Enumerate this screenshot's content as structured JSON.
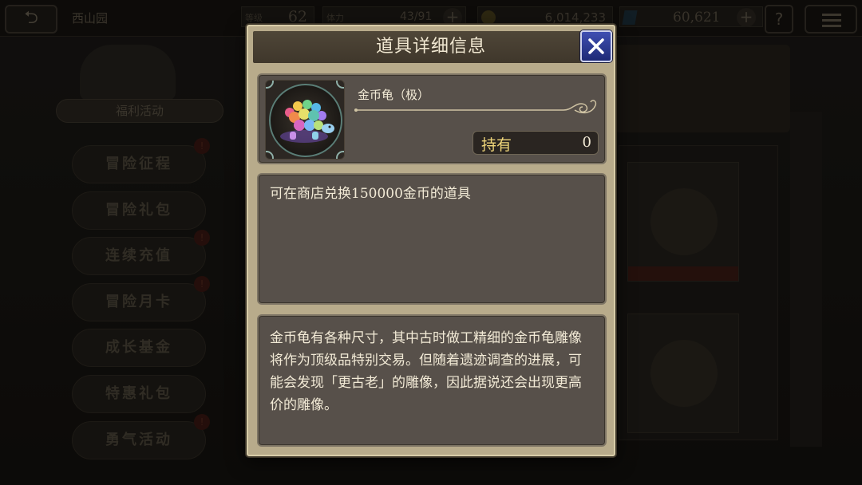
{
  "topbar": {
    "back_icon": "back-arrow-icon",
    "player_name": "西山园",
    "level_label": "等级",
    "level_value": "62",
    "stamina_label": "体力",
    "stamina_value": "43/91",
    "gil_value": "6,014,233",
    "gem_value": "60,621",
    "help_label": "?",
    "plus_label": "+"
  },
  "sidebar": {
    "header": "福利活动",
    "items": [
      {
        "label": "冒险征程",
        "badge": "!"
      },
      {
        "label": "冒险礼包",
        "badge": ""
      },
      {
        "label": "连续充值",
        "badge": "!"
      },
      {
        "label": "冒险月卡",
        "badge": "!"
      },
      {
        "label": "成长基金",
        "badge": ""
      },
      {
        "label": "特惠礼包",
        "badge": ""
      },
      {
        "label": "勇气活动",
        "badge": "!"
      }
    ]
  },
  "modal": {
    "title": "道具详细信息",
    "close_icon": "close-x-icon",
    "item": {
      "name": "金币龟（极）",
      "icon": "rainbow-gold-turtle-icon",
      "held_label": "持有",
      "held_value": "0"
    },
    "description": "可在商店兑换150000金币的道具",
    "lore": "金币龟有各种尺寸，其中古时做工精细的金币龟雕像将作为顶级品特别交易。但随着遗迹调查的进展，可能会发现「更古老」的雕像，因此据说还会出现更高价的雕像。"
  },
  "colors": {
    "modal_frame": "#b8ab8b",
    "panel_bg": "#57504a",
    "title_bar": "#4a4134",
    "close_button": "#2b3a96",
    "held_label": "#f0d67a"
  }
}
